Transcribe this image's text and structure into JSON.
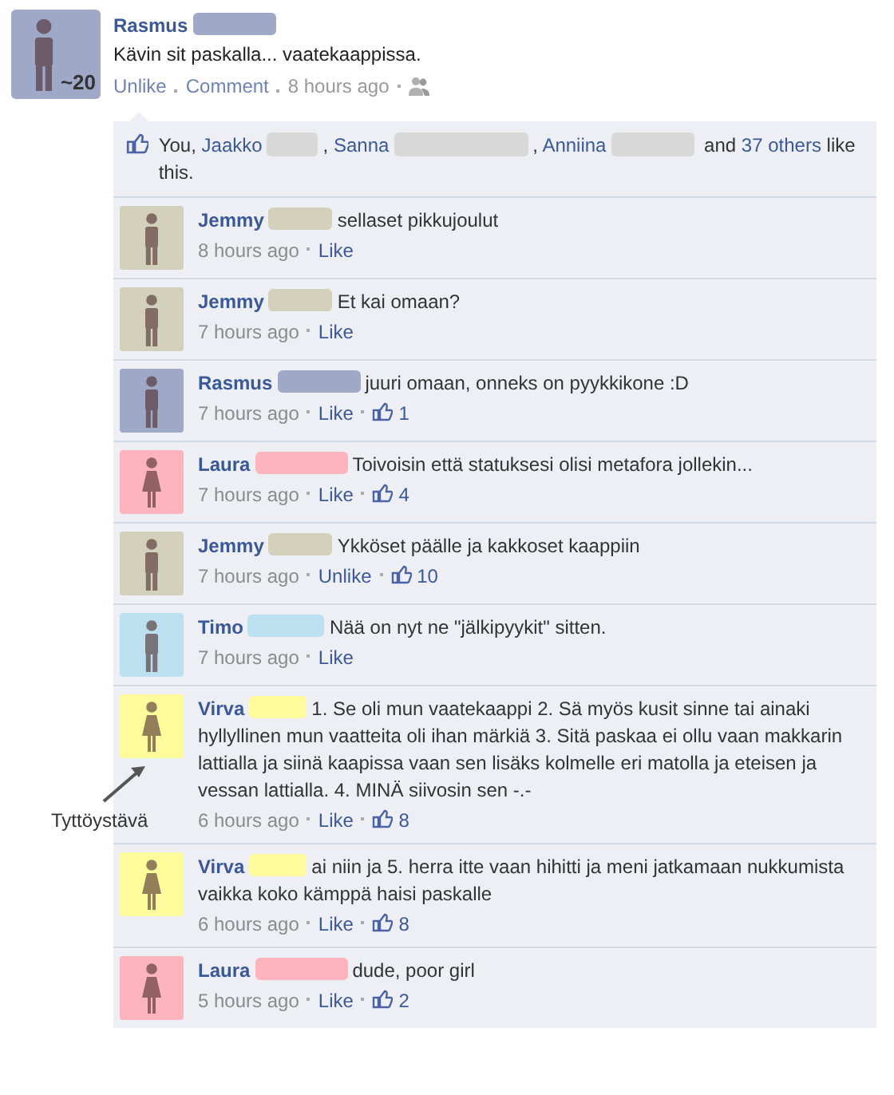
{
  "post": {
    "author": "Rasmus",
    "color": "#a0a8c8",
    "kind": "male",
    "avatar_badge": "~20",
    "text": "Kävin sit paskalla... vaatekaappissa.",
    "actions": [
      "Unlike",
      "Comment"
    ],
    "time": "8 hours ago"
  },
  "likes": {
    "parts": [
      {
        "kind": "text",
        "text": "You, "
      },
      {
        "kind": "link",
        "text": "Jaakko"
      },
      {
        "kind": "redacted",
        "color": "#d8d8d8"
      },
      {
        "kind": "text",
        "text": ", "
      },
      {
        "kind": "link",
        "text": "Sanna"
      },
      {
        "kind": "redacted",
        "color": "#d8d8d8"
      },
      {
        "kind": "text",
        "text": ", "
      },
      {
        "kind": "link",
        "text": "Anniina"
      },
      {
        "kind": "redacted",
        "color": "#d8d8d8"
      },
      {
        "kind": "text",
        "text": " and "
      },
      {
        "kind": "link",
        "text": "37 others"
      },
      {
        "kind": "text",
        "text": " like this."
      }
    ]
  },
  "comments": [
    {
      "author": "Jemmy",
      "color": "#d3d1bb",
      "kind": "male",
      "text": "sellaset pikkujoulut",
      "time": "8 hours ago",
      "action": "Like"
    },
    {
      "author": "Jemmy",
      "color": "#d3d1bb",
      "kind": "male",
      "text": "Et kai omaan?",
      "time": "7 hours ago",
      "action": "Like"
    },
    {
      "author": "Rasmus",
      "color": "#a0a8c8",
      "kind": "male",
      "text": "juuri omaan, onneks on pyykkikone :D",
      "time": "7 hours ago",
      "action": "Like",
      "likes": "1"
    },
    {
      "author": "Laura",
      "color": "#fdb4bc",
      "kind": "female",
      "text": "Toivoisin että statuksesi olisi metafora jollekin...",
      "time": "7 hours ago",
      "action": "Like",
      "likes": "4"
    },
    {
      "author": "Jemmy",
      "color": "#d3d1bb",
      "kind": "male",
      "text": "Ykköset päälle ja kakkoset kaappiin",
      "time": "7 hours ago",
      "action": "Unlike",
      "likes": "10"
    },
    {
      "author": "Timo",
      "color": "#bde0f0",
      "kind": "male",
      "text": "Nää on nyt ne \"jälkipyykit\" sitten.",
      "time": "7 hours ago",
      "action": "Like"
    },
    {
      "author": "Virva",
      "color": "#fdfb9c",
      "kind": "female",
      "text": "1. Se oli mun vaatekaappi 2. Sä myös kusit sinne tai ainaki hyllyllinen mun vaatteita oli ihan märkiä 3. Sitä paskaa ei ollu vaan makkarin lattialla ja siinä kaapissa vaan sen lisäks kolmelle eri matolla ja eteisen ja vessan lattialla. 4. MINÄ siivosin sen -.-",
      "time": "6 hours ago",
      "action": "Like",
      "likes": "8"
    },
    {
      "author": "Virva",
      "color": "#fdfb9c",
      "kind": "female",
      "text": "ai niin ja 5. herra itte vaan hihitti ja meni jatkamaan nukkumista vaikka koko kämppä haisi paskalle",
      "time": "6 hours ago",
      "action": "Like",
      "likes": "8"
    },
    {
      "author": "Laura",
      "color": "#fdb4bc",
      "kind": "female",
      "text": "dude, poor girl",
      "time": "5 hours ago",
      "action": "Like",
      "likes": "2"
    }
  ],
  "annotation": {
    "text": "Tyttöystävä"
  }
}
